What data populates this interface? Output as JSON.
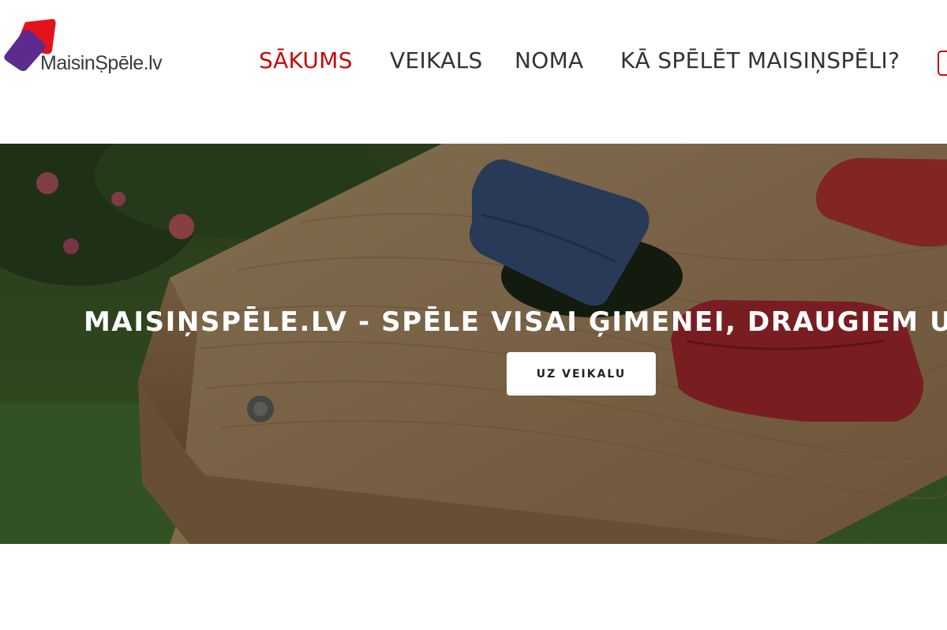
{
  "brand": {
    "logo_text": "MaisinṢpēle.lv",
    "colors": {
      "primary_red": "#c80b0b",
      "logo_red": "#e3131b",
      "logo_purple": "#5b2c8e"
    }
  },
  "nav": {
    "items": [
      {
        "label": "SĀKUMS",
        "active": true
      },
      {
        "label": "VEIKALS",
        "active": false
      },
      {
        "label": "NOMA",
        "active": false
      },
      {
        "label": "KĀ SPĒLĒT MAISIŅSPĒLI?",
        "active": false
      }
    ]
  },
  "hero": {
    "title": "MAISIŅSPĒLE.LV - SPĒLE VISAI ĢIMENEI, DRAUGIEM UN KOLĒĢIEM",
    "button_label": "UZ VEIKALU"
  }
}
